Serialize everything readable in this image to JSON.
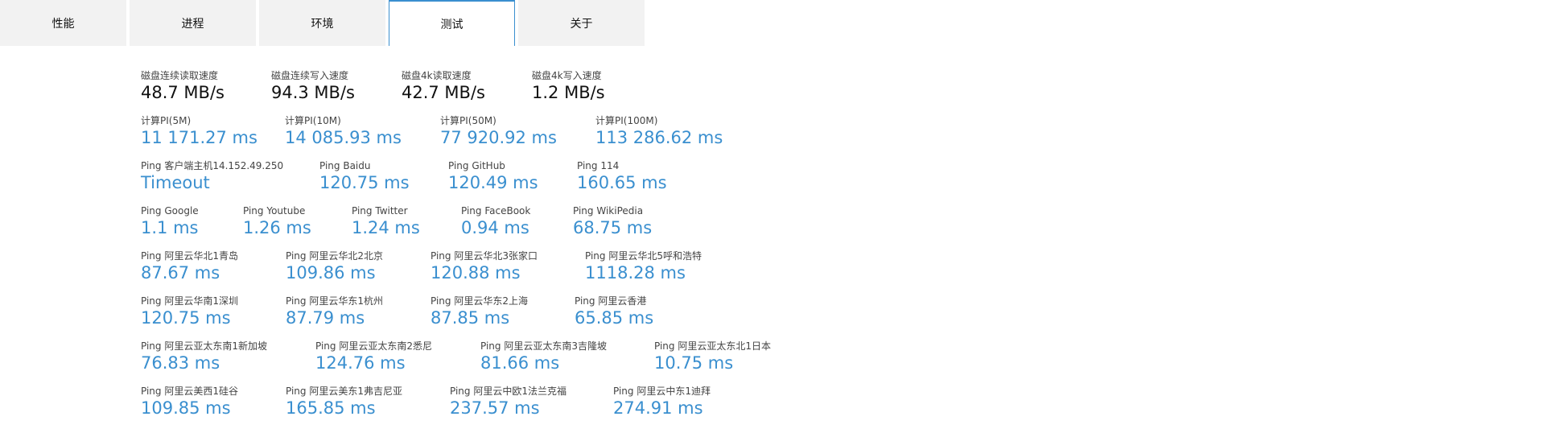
{
  "tabs": [
    {
      "label": "性能"
    },
    {
      "label": "进程"
    },
    {
      "label": "环境"
    },
    {
      "label": "测试"
    },
    {
      "label": "关于"
    }
  ],
  "rows": [
    [
      {
        "label": "磁盘连续读取速度",
        "value": "48.7 MB/s"
      },
      {
        "label": "磁盘连续写入速度",
        "value": "94.3 MB/s"
      },
      {
        "label": "磁盘4k读取速度",
        "value": "42.7 MB/s"
      },
      {
        "label": "磁盘4k写入速度",
        "value": "1.2 MB/s"
      }
    ],
    [
      {
        "label": "计算PI(5M)",
        "value": "11 171.27 ms"
      },
      {
        "label": "计算PI(10M)",
        "value": "14 085.93 ms"
      },
      {
        "label": "计算PI(50M)",
        "value": "77 920.92 ms"
      },
      {
        "label": "计算PI(100M)",
        "value": "113 286.62 ms"
      }
    ],
    [
      {
        "label": "Ping 客户端主机14.152.49.250",
        "value": "Timeout"
      },
      {
        "label": "Ping Baidu",
        "value": "120.75 ms"
      },
      {
        "label": "Ping GitHub",
        "value": "120.49 ms"
      },
      {
        "label": "Ping 114",
        "value": "160.65 ms"
      }
    ],
    [
      {
        "label": "Ping Google",
        "value": "1.1 ms"
      },
      {
        "label": "Ping Youtube",
        "value": "1.26 ms"
      },
      {
        "label": "Ping Twitter",
        "value": "1.24 ms"
      },
      {
        "label": "Ping FaceBook",
        "value": "0.94 ms"
      },
      {
        "label": "Ping WikiPedia",
        "value": "68.75 ms"
      }
    ],
    [
      {
        "label": "Ping 阿里云华北1青岛",
        "value": "87.67 ms"
      },
      {
        "label": "Ping 阿里云华北2北京",
        "value": "109.86 ms"
      },
      {
        "label": "Ping 阿里云华北3张家口",
        "value": "120.88 ms"
      },
      {
        "label": "Ping 阿里云华北5呼和浩特",
        "value": "1118.28 ms"
      }
    ],
    [
      {
        "label": "Ping 阿里云华南1深圳",
        "value": "120.75 ms"
      },
      {
        "label": "Ping 阿里云华东1杭州",
        "value": "87.79 ms"
      },
      {
        "label": "Ping 阿里云华东2上海",
        "value": "87.85 ms"
      },
      {
        "label": "Ping 阿里云香港",
        "value": "65.85 ms"
      }
    ],
    [
      {
        "label": "Ping 阿里云亚太东南1新加坡",
        "value": "76.83 ms"
      },
      {
        "label": "Ping 阿里云亚太东南2悉尼",
        "value": "124.76 ms"
      },
      {
        "label": "Ping 阿里云亚太东南3吉隆坡",
        "value": "81.66 ms"
      },
      {
        "label": "Ping 阿里云亚太东北1日本",
        "value": "10.75 ms"
      }
    ],
    [
      {
        "label": "Ping 阿里云美西1硅谷",
        "value": "109.85 ms"
      },
      {
        "label": "Ping 阿里云美东1弗吉尼亚",
        "value": "165.85 ms"
      },
      {
        "label": "Ping 阿里云中欧1法兰克福",
        "value": "237.57 ms"
      },
      {
        "label": "Ping 阿里云中东1迪拜",
        "value": "274.91 ms"
      }
    ]
  ]
}
